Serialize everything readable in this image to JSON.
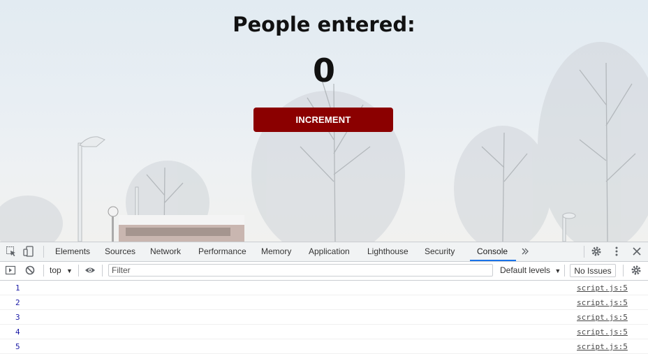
{
  "page": {
    "title": "People entered:",
    "count": "0",
    "increment_label": "INCREMENT",
    "colors": {
      "button": "#8b0000",
      "button_text": "#ffffff"
    }
  },
  "devtools": {
    "icons": [
      "inspect-element-icon",
      "device-toolbar-icon",
      "more-tabs-icon",
      "settings-gear-icon",
      "kebab-menu-icon",
      "close-icon",
      "sidebar-toggle-icon",
      "clear-console-icon",
      "eye-icon",
      "console-settings-icon"
    ],
    "tabs": [
      {
        "label": "Elements"
      },
      {
        "label": "Sources"
      },
      {
        "label": "Network"
      },
      {
        "label": "Performance"
      },
      {
        "label": "Memory"
      },
      {
        "label": "Application"
      },
      {
        "label": "Lighthouse"
      },
      {
        "label": "Security"
      },
      {
        "label": "Console"
      }
    ],
    "active_tab": "Console",
    "context": "top",
    "filter_placeholder": "Filter",
    "levels_label": "Default levels",
    "issues_label": "No Issues",
    "accent": "#1a73e8",
    "logs": [
      {
        "value": "1",
        "source": "script.js:5"
      },
      {
        "value": "2",
        "source": "script.js:5"
      },
      {
        "value": "3",
        "source": "script.js:5"
      },
      {
        "value": "4",
        "source": "script.js:5"
      },
      {
        "value": "5",
        "source": "script.js:5"
      }
    ]
  }
}
